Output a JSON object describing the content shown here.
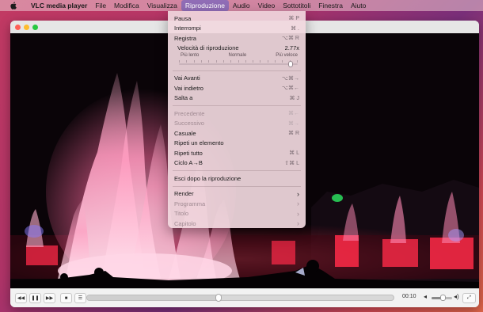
{
  "menubar": {
    "items": [
      {
        "label": "VLC media player"
      },
      {
        "label": "File"
      },
      {
        "label": "Modifica"
      },
      {
        "label": "Visualizza"
      },
      {
        "label": "Riproduzione"
      },
      {
        "label": "Audio"
      },
      {
        "label": "Video"
      },
      {
        "label": "Sottotitoli"
      },
      {
        "label": "Finestra"
      },
      {
        "label": "Aiuto"
      }
    ],
    "active_index": 4
  },
  "menu": {
    "pause": {
      "label": "Pausa",
      "shortcut": "⌘ P"
    },
    "stop": {
      "label": "Interrompi",
      "shortcut": "⌘ ."
    },
    "record": {
      "label": "Registra",
      "shortcut": "⌥⌘ R"
    },
    "speed": {
      "label": "Velocità di riproduzione",
      "value": "2.77x",
      "slow_label": "Più lento",
      "normal_label": "Normale",
      "fast_label": "Più veloce",
      "position_fraction": 0.94
    },
    "forward": {
      "label": "Vai Avanti",
      "shortcut": "⌥⌘→"
    },
    "back": {
      "label": "Vai indietro",
      "shortcut": "⌥⌘←"
    },
    "jump": {
      "label": "Salta a",
      "shortcut": "⌘ J"
    },
    "previous": {
      "label": "Precedente",
      "shortcut": "⌘←"
    },
    "next": {
      "label": "Successivo",
      "shortcut": "⌘→"
    },
    "random": {
      "label": "Casuale",
      "shortcut": "⌘ R"
    },
    "repeat_one": {
      "label": "Ripeti un elemento",
      "shortcut": ""
    },
    "repeat_all": {
      "label": "Ripeti tutto",
      "shortcut": "⌘ L"
    },
    "ab_loop": {
      "label": "Ciclo A→B",
      "shortcut": "⇧⌘ L"
    },
    "exit_after": {
      "label": "Esci dopo la riproduzione"
    },
    "render": {
      "label": "Render"
    },
    "program": {
      "label": "Programma"
    },
    "title": {
      "label": "Titolo"
    },
    "chapter": {
      "label": "Capitolo"
    }
  },
  "controls": {
    "elapsed": "00:10",
    "progress_fraction": 0.43,
    "volume_fraction": 0.55
  },
  "icons": {
    "apple": "apple-logo-icon",
    "rewind": "rewind-icon",
    "play_pause": "play-pause-icon",
    "fast_forward": "fast-forward-icon",
    "stop": "stop-icon",
    "playlist": "playlist-icon",
    "volume_low": "volume-low-icon",
    "volume_high": "volume-high-icon",
    "fullscreen": "fullscreen-icon"
  },
  "colors": {
    "menu_highlight": "#5a5ac8",
    "fountain_pink": "#ff6aa0",
    "fountain_red": "#ff1e3c",
    "green_light": "#29d15a"
  }
}
